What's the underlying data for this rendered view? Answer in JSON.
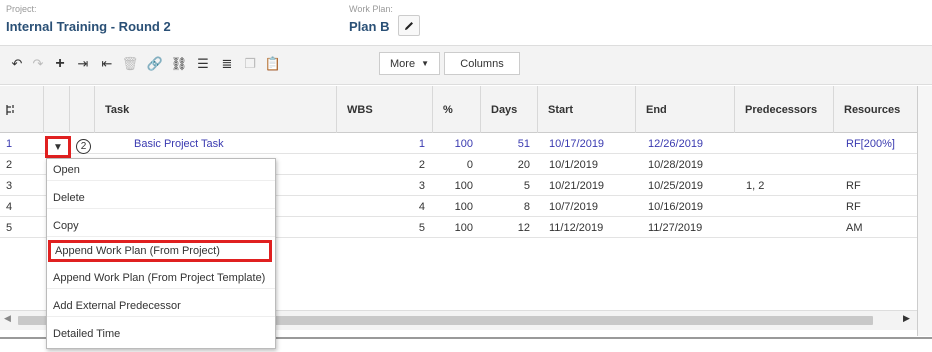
{
  "project": {
    "label": "Project:",
    "name": "Internal Training - Round 2"
  },
  "workplan": {
    "label": "Work Plan:",
    "name": "Plan B"
  },
  "toolbar": {
    "more_label": "More",
    "columns_label": "Columns"
  },
  "grid": {
    "headers": [
      "Task",
      "WBS",
      "%",
      "Days",
      "Start",
      "End",
      "Predecessors",
      "Resources"
    ],
    "rows": [
      {
        "num": "1",
        "task": "Basic Project Task",
        "wbs": "1",
        "pct": "100",
        "days": "51",
        "start": "10/17/2019",
        "end": "12/26/2019",
        "pred": "",
        "res": "RF[200%]"
      },
      {
        "num": "2",
        "task": "",
        "wbs": "2",
        "pct": "0",
        "days": "20",
        "start": "10/1/2019",
        "end": "10/28/2019",
        "pred": "",
        "res": ""
      },
      {
        "num": "3",
        "task": "",
        "wbs": "3",
        "pct": "100",
        "days": "5",
        "start": "10/21/2019",
        "end": "10/25/2019",
        "pred": "1, 2",
        "res": "RF"
      },
      {
        "num": "4",
        "task": "",
        "wbs": "4",
        "pct": "100",
        "days": "8",
        "start": "10/7/2019",
        "end": "10/16/2019",
        "pred": "",
        "res": "RF"
      },
      {
        "num": "5",
        "task": "",
        "wbs": "5",
        "pct": "100",
        "days": "12",
        "start": "11/12/2019",
        "end": "11/27/2019",
        "pred": "",
        "res": "AM"
      }
    ]
  },
  "callout_number": "2",
  "context_menu": {
    "items": [
      "Open",
      "Delete",
      "Copy",
      "Append Work Plan (From Project)",
      "Append Work Plan (From Project Template)",
      "Add External Predecessor",
      "Detailed Time"
    ],
    "highlighted_index": 3
  },
  "colors": {
    "title_blue": "#2a5076",
    "link_purple": "#3a3ab0",
    "highlight_red": "#e02020"
  }
}
